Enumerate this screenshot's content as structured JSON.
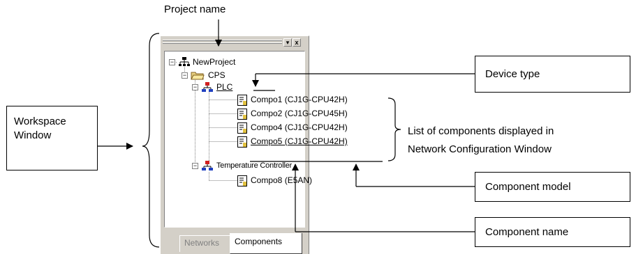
{
  "annotations": {
    "project_name": "Project name",
    "device_type": "Device type",
    "component_model": "Component model",
    "component_name": "Component name",
    "workspace_line1": "Workspace",
    "workspace_line2": "Window",
    "components_list_line1": "List of components displayed in",
    "components_list_line2": "Network Configuration Window"
  },
  "workspace": {
    "title_buttons": [
      "▾",
      "x"
    ],
    "tree": {
      "project": "NewProject",
      "group": "CPS",
      "plc": "PLC",
      "components": [
        "Compo1 (CJ1G-CPU42H)",
        "Compo2 (CJ1G-CPU45H)",
        "Compo4 (CJ1G-CPU42H)",
        "Compo5 (CJ1G-CPU42H)"
      ],
      "temp_controller": "Temperature Controller",
      "temp_component": "Compo8 (E5AN)"
    },
    "tabs": [
      "Networks",
      "Components"
    ],
    "active_tab": "Components"
  }
}
